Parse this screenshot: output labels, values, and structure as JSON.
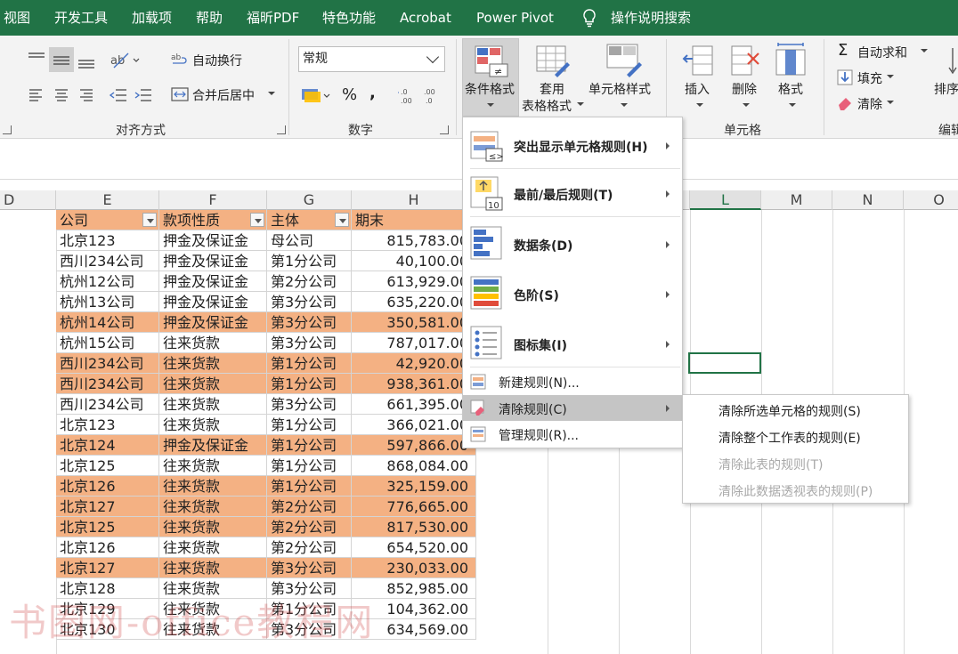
{
  "menubar": {
    "tabs": [
      "视图",
      "开发工具",
      "加载项",
      "帮助",
      "福昕PDF",
      "特色功能",
      "Acrobat",
      "Power Pivot"
    ],
    "search_label": "操作说明搜索"
  },
  "ribbon": {
    "align_group": "对齐方式",
    "wrap_text": "自动换行",
    "merge_center": "合并后居中",
    "number_group": "数字",
    "number_format": "常规",
    "percent": "%",
    "comma": ",",
    "inc_decimal": "←.0\n.00",
    "cf_label": "条件格式",
    "table_format_1": "套用",
    "table_format_2": "表格格式",
    "cell_style": "单元格样式",
    "insert": "插入",
    "delete": "删除",
    "format": "格式",
    "cells_group": "单元格",
    "autosum": "自动求和",
    "fill": "填充",
    "clear": "清除",
    "sort": "排序",
    "edit_group": "编辑"
  },
  "columns": [
    "D",
    "E",
    "F",
    "G",
    "H",
    "L",
    "M",
    "N",
    "O"
  ],
  "table": {
    "headers": [
      "公司",
      "款项性质",
      "主体",
      "期末"
    ],
    "rows": [
      {
        "c": "北京123",
        "t": "押金及保证金",
        "s": "母公司",
        "v": "815,783.00",
        "hl": false
      },
      {
        "c": "西川234公司",
        "t": "押金及保证金",
        "s": "第1分公司",
        "v": "40,100.00",
        "hl": false
      },
      {
        "c": "杭州12公司",
        "t": "押金及保证金",
        "s": "第2分公司",
        "v": "613,929.00",
        "hl": false
      },
      {
        "c": "杭州13公司",
        "t": "押金及保证金",
        "s": "第3分公司",
        "v": "635,220.00",
        "hl": false
      },
      {
        "c": "杭州14公司",
        "t": "押金及保证金",
        "s": "第3分公司",
        "v": "350,581.00",
        "hl": true
      },
      {
        "c": "杭州15公司",
        "t": "往来货款",
        "s": "第3分公司",
        "v": "787,017.00",
        "hl": false
      },
      {
        "c": "西川234公司",
        "t": "往来货款",
        "s": "第1分公司",
        "v": "42,920.00",
        "hl": true
      },
      {
        "c": "西川234公司",
        "t": "往来货款",
        "s": "第1分公司",
        "v": "938,361.00",
        "hl": true
      },
      {
        "c": "西川234公司",
        "t": "往来货款",
        "s": "第3分公司",
        "v": "661,395.00",
        "hl": false
      },
      {
        "c": "北京123",
        "t": "往来货款",
        "s": "第1分公司",
        "v": "366,021.00",
        "hl": false
      },
      {
        "c": "北京124",
        "t": "押金及保证金",
        "s": "第1分公司",
        "v": "597,866.00",
        "hl": true
      },
      {
        "c": "北京125",
        "t": "往来货款",
        "s": "第1分公司",
        "v": "868,084.00",
        "hl": false
      },
      {
        "c": "北京126",
        "t": "往来货款",
        "s": "第1分公司",
        "v": "325,159.00",
        "hl": true
      },
      {
        "c": "北京127",
        "t": "往来货款",
        "s": "第2分公司",
        "v": "776,665.00",
        "hl": true
      },
      {
        "c": "北京125",
        "t": "往来货款",
        "s": "第2分公司",
        "v": "817,530.00",
        "hl": true
      },
      {
        "c": "北京126",
        "t": "往来货款",
        "s": "第2分公司",
        "v": "654,520.00",
        "hl": false
      },
      {
        "c": "北京127",
        "t": "往来货款",
        "s": "第3分公司",
        "v": "230,033.00",
        "hl": true
      },
      {
        "c": "北京128",
        "t": "往来货款",
        "s": "第3分公司",
        "v": "852,985.00",
        "hl": false
      },
      {
        "c": "北京129",
        "t": "往来货款",
        "s": "第1分公司",
        "v": "104,362.00",
        "hl": false
      },
      {
        "c": "北京130",
        "t": "往来货款",
        "s": "第3分公司",
        "v": "634,569.00",
        "hl": false
      }
    ]
  },
  "cf_menu": {
    "items": [
      {
        "label": "突出显示单元格规则(H)",
        "icon": "highlight-rules-icon"
      },
      {
        "label": "最前/最后规则(T)",
        "icon": "top-bottom-rules-icon"
      },
      {
        "label": "数据条(D)",
        "icon": "data-bars-icon"
      },
      {
        "label": "色阶(S)",
        "icon": "color-scales-icon"
      },
      {
        "label": "图标集(I)",
        "icon": "icon-sets-icon"
      }
    ],
    "new_rule": "新建规则(N)...",
    "clear_rules": "清除规则(C)",
    "manage_rules": "管理规则(R)..."
  },
  "clear_submenu": {
    "items": [
      {
        "label": "清除所选单元格的规则(S)",
        "disabled": false
      },
      {
        "label": "清除整个工作表的规则(E)",
        "disabled": false
      },
      {
        "label": "清除此表的规则(T)",
        "disabled": true
      },
      {
        "label": "清除此数据透视表的规则(P)",
        "disabled": true
      }
    ]
  },
  "watermark": "书圈网-office教程网",
  "colors": {
    "excel_green": "#217346",
    "highlight": "#f4b183",
    "menu_active": "#c5c5c5"
  }
}
